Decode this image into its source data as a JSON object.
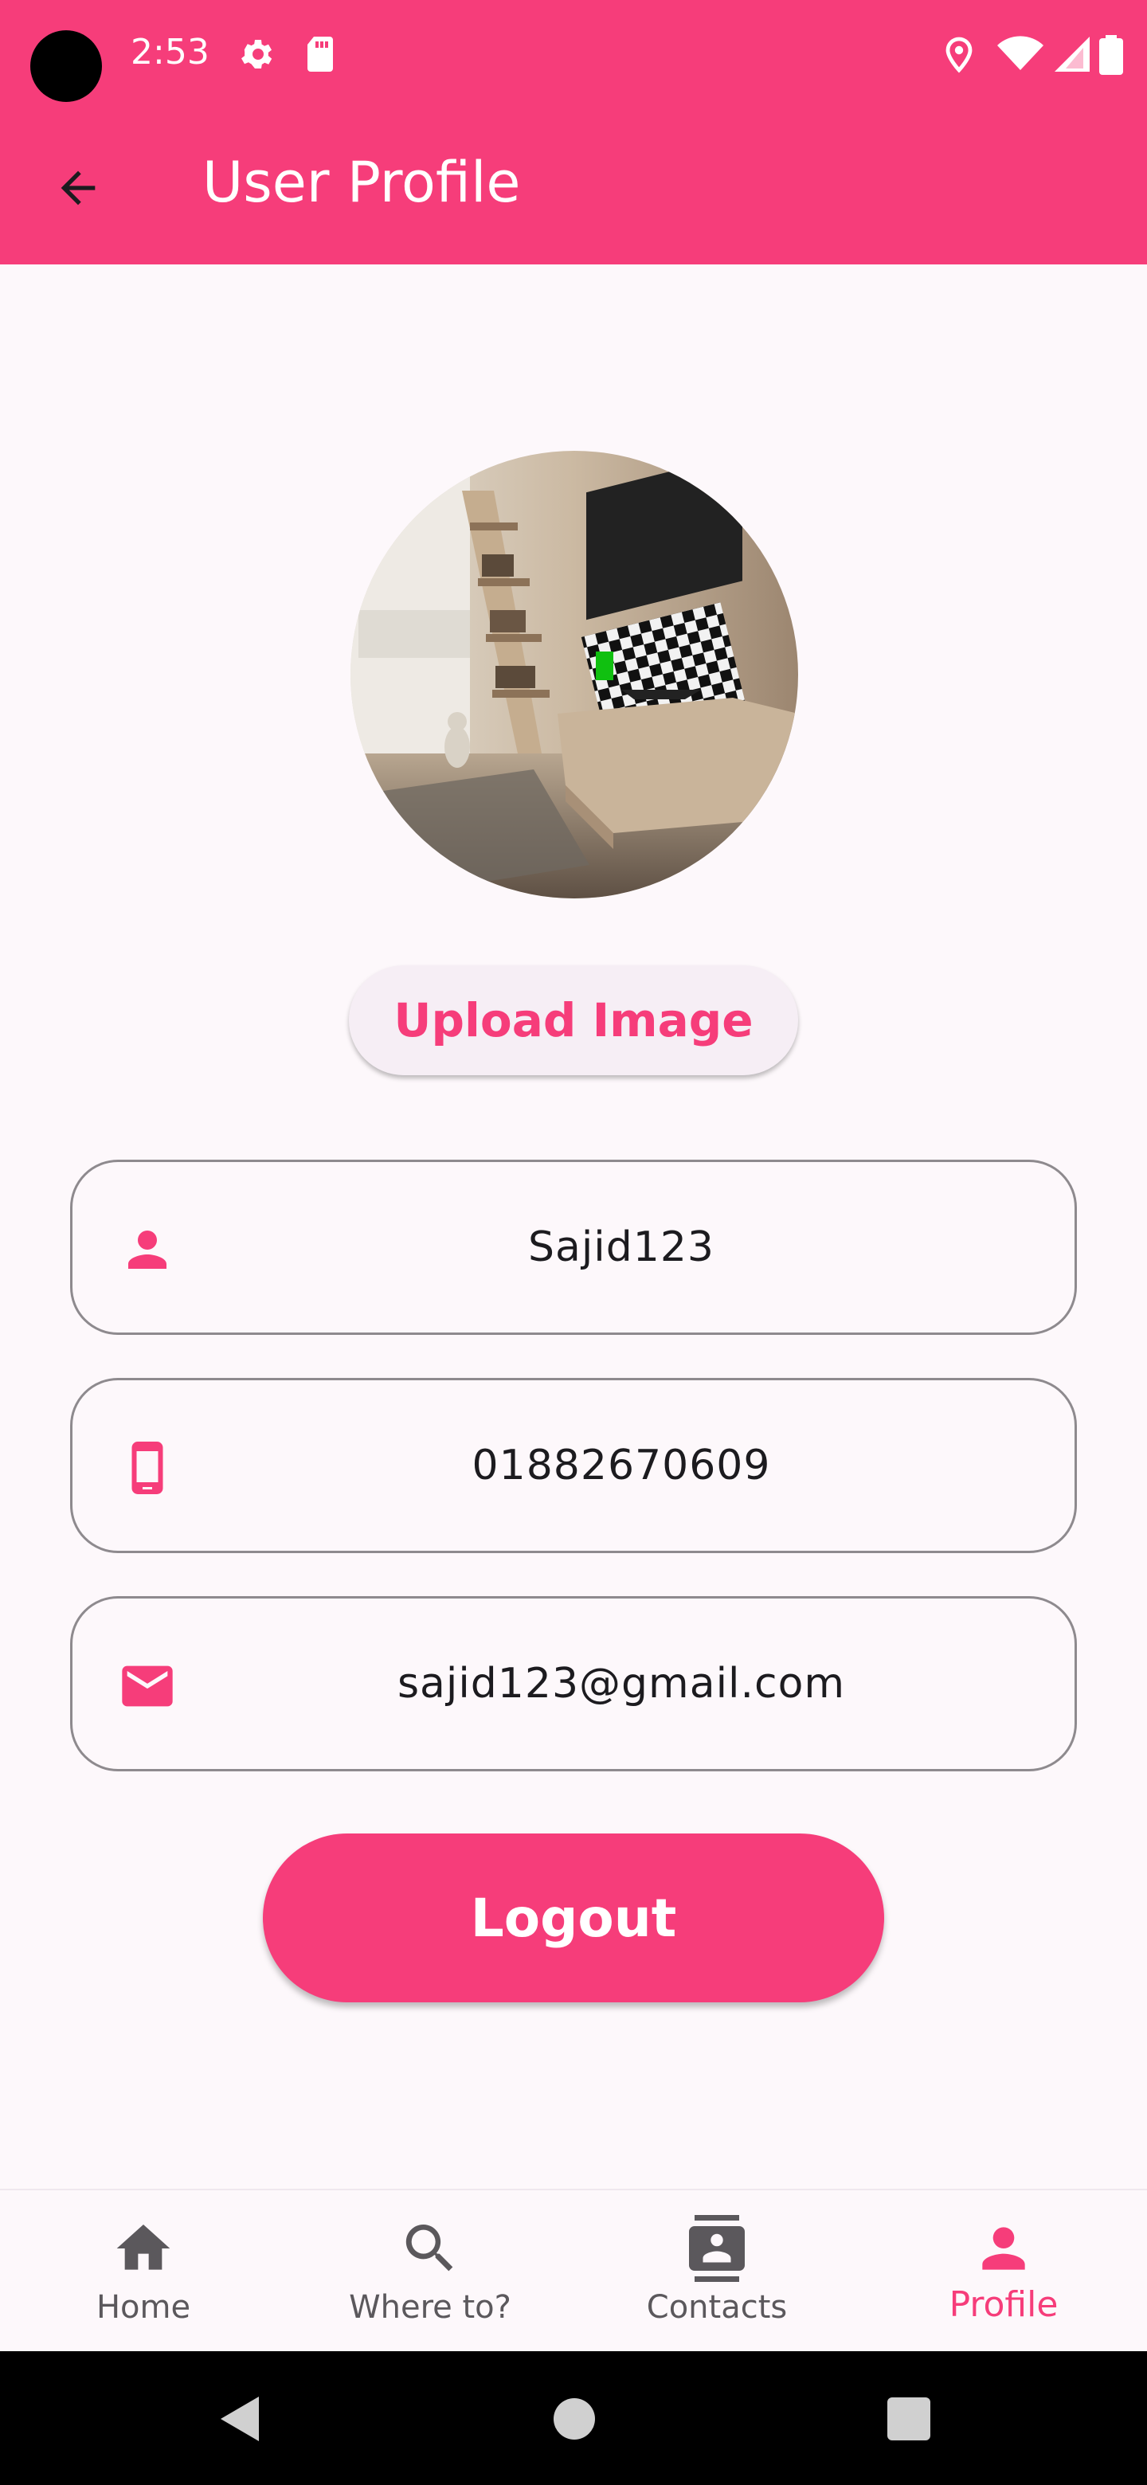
{
  "status_bar": {
    "time": "2:53",
    "icons": [
      "settings-icon",
      "sd-card-icon",
      "location-icon",
      "wifi-icon",
      "signal-icon",
      "battery-icon"
    ]
  },
  "app_bar": {
    "title": "User Profile",
    "back_icon": "arrow-left-icon"
  },
  "profile": {
    "avatar_description_icon": "profile-photo",
    "upload_button_label": "Upload Image",
    "fields": [
      {
        "icon": "person-icon",
        "value": "Sajid123"
      },
      {
        "icon": "phone-icon",
        "value": "01882670609"
      },
      {
        "icon": "mail-icon",
        "value": "sajid123@gmail.com"
      }
    ],
    "logout_label": "Logout"
  },
  "bottom_nav": {
    "items": [
      {
        "icon": "home-icon",
        "label": "Home",
        "active": false
      },
      {
        "icon": "search-icon",
        "label": "Where to?",
        "active": false
      },
      {
        "icon": "contacts-icon",
        "label": "Contacts",
        "active": false
      },
      {
        "icon": "person-icon",
        "label": "Profile",
        "active": true
      }
    ]
  },
  "colors": {
    "primary": "#f63d7a",
    "background": "#fdf8fb",
    "nav_inactive": "#5b585c",
    "field_border": "#8e8a8e"
  }
}
